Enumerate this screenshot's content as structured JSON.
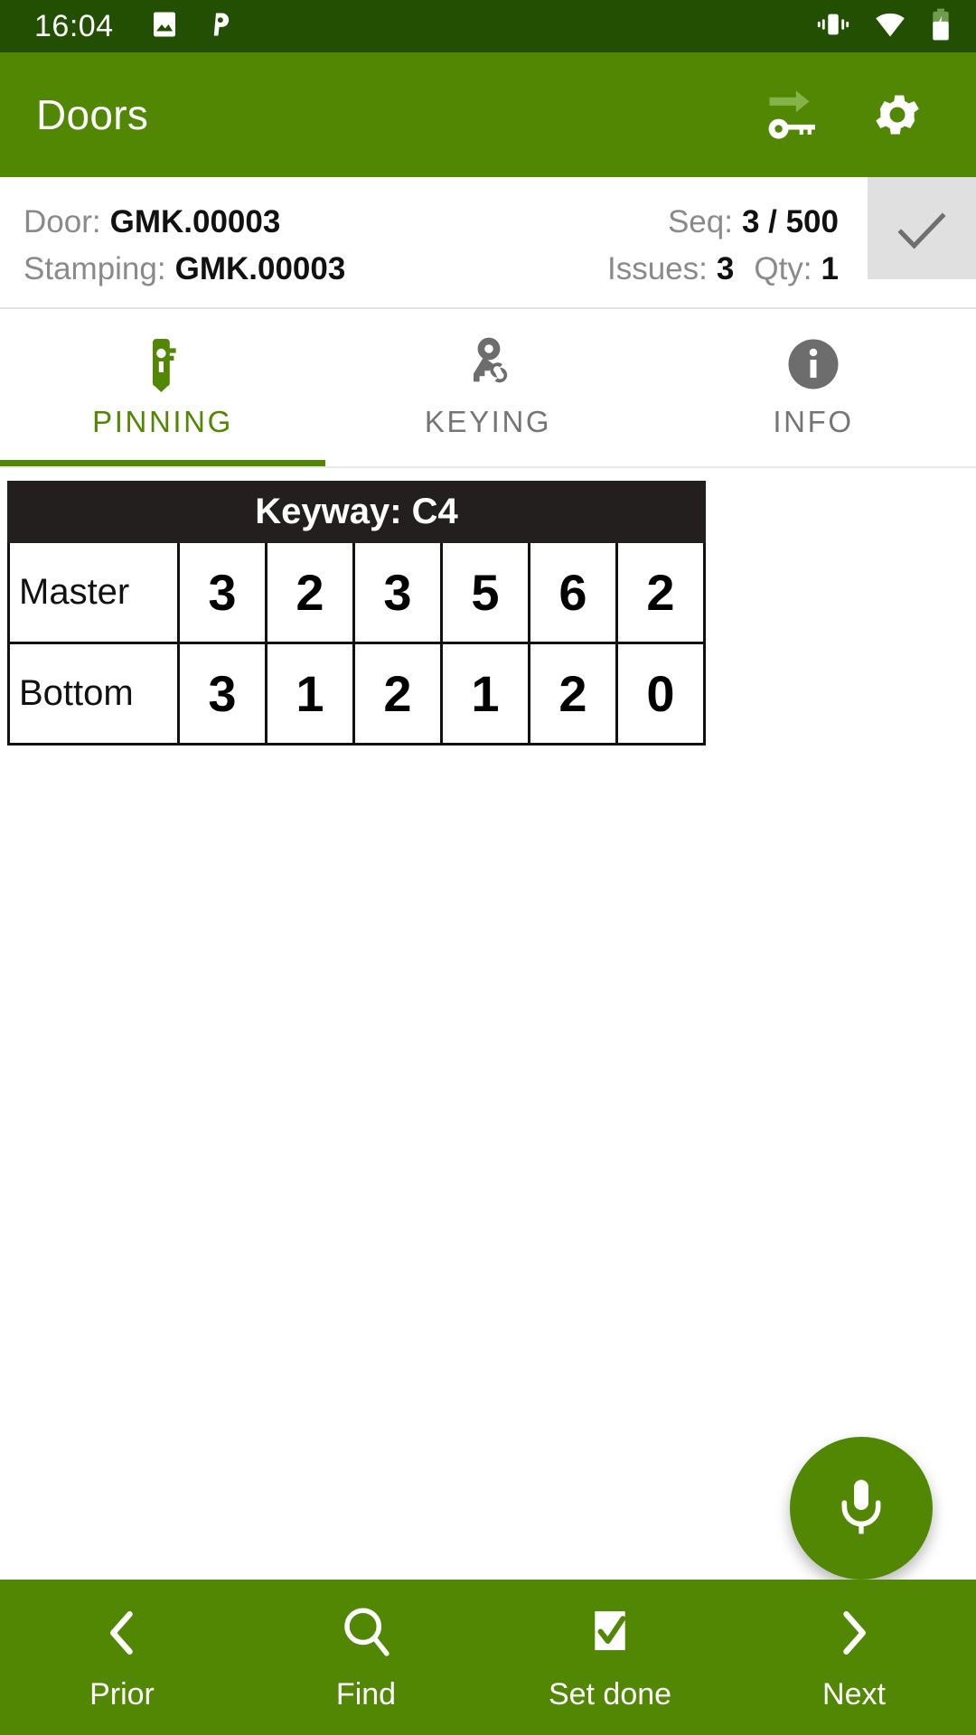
{
  "status_bar": {
    "time": "16:04",
    "left_icons": [
      "image-icon",
      "pinterest-p-icon"
    ],
    "right_icons": [
      "vibrate-icon",
      "wifi-icon",
      "battery-charging-icon"
    ],
    "background": "#234f03"
  },
  "app_bar": {
    "title": "Doors",
    "background": "#528704",
    "actions": [
      {
        "name": "transfer-key-icon",
        "label": "Transfer key"
      },
      {
        "name": "gear-icon",
        "label": "Settings"
      }
    ]
  },
  "info_panel": {
    "door_label": "Door:",
    "door_value": "GMK.00003",
    "seq_label": "Seq:",
    "seq_value": "3 / 500",
    "stamping_label": "Stamping:",
    "stamping_value": "GMK.00003",
    "issues_label": "Issues:",
    "issues_value": "3",
    "qty_label": "Qty:",
    "qty_value": "1",
    "confirm_icon": "check-icon"
  },
  "tabs": [
    {
      "label": "PINNING",
      "icon": "lock-pin-icon",
      "active": true
    },
    {
      "label": "KEYING",
      "icon": "key-link-icon",
      "active": false
    },
    {
      "label": "INFO",
      "icon": "info-circle-icon",
      "active": false
    }
  ],
  "pinning_table": {
    "keyway_header": "Keyway: C4",
    "rows": [
      {
        "label": "Master",
        "values": [
          "3",
          "2",
          "3",
          "5",
          "6",
          "2"
        ]
      },
      {
        "label": "Bottom",
        "values": [
          "3",
          "1",
          "2",
          "1",
          "2",
          "0"
        ]
      }
    ]
  },
  "fab": {
    "icon": "microphone-icon",
    "color": "#528704"
  },
  "bottom_nav": [
    {
      "label": "Prior",
      "icon": "chevron-left-icon"
    },
    {
      "label": "Find",
      "icon": "search-icon"
    },
    {
      "label": "Set done",
      "icon": "checkbox-checked-icon"
    },
    {
      "label": "Next",
      "icon": "chevron-right-icon"
    }
  ],
  "colors": {
    "primary": "#528704",
    "status_bar": "#234f03",
    "table_header": "#231f1e",
    "muted_text": "#8a8a8a"
  }
}
